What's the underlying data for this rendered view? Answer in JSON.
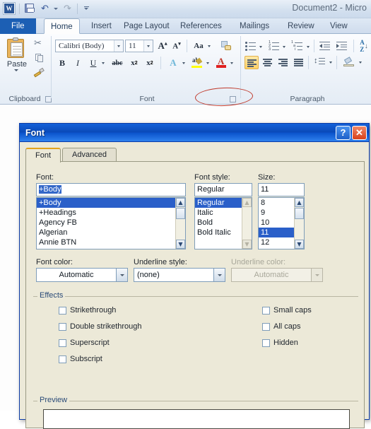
{
  "window": {
    "document_title": "Document2 - Micro",
    "app_logo": "word-logo",
    "quick_access": [
      {
        "name": "save",
        "icon": "floppy-disk-icon"
      },
      {
        "name": "undo",
        "icon": "undo-arrow-icon"
      },
      {
        "name": "redo",
        "icon": "redo-arrow-icon"
      },
      {
        "name": "customize",
        "icon": "customize-qat-icon"
      }
    ]
  },
  "ribbon": {
    "tabs": [
      {
        "label": "File",
        "active": false,
        "style": "file"
      },
      {
        "label": "Home",
        "active": true
      },
      {
        "label": "Insert",
        "active": false
      },
      {
        "label": "Page Layout",
        "active": false
      },
      {
        "label": "References",
        "active": false
      },
      {
        "label": "Mailings",
        "active": false
      },
      {
        "label": "Review",
        "active": false
      },
      {
        "label": "View",
        "active": false
      }
    ],
    "groups": [
      {
        "label": "Clipboard"
      },
      {
        "label": "Font"
      },
      {
        "label": "Paragraph"
      }
    ],
    "clipboard": {
      "paste_label": "Paste",
      "cut_icon": "scissors-icon",
      "copy_icon": "copy-icon",
      "format_painter_icon": "format-painter-icon"
    },
    "font_group": {
      "font_name": "Calibri (Body)",
      "font_size": "11",
      "grow_font": "A",
      "shrink_font": "A",
      "change_case": "Aa",
      "clear_formatting_icon": "clear-formatting-icon",
      "bold": "B",
      "italic": "I",
      "underline": "U",
      "strikethrough": "abc",
      "subscript": "x",
      "superscript": "x",
      "text_effects": "A",
      "highlight": "ab",
      "font_color": "A",
      "font_color_swatch": "#e02020",
      "highlight_swatch": "#ffff00"
    },
    "paragraph_group": {
      "bullets_icon": "bullet-list-icon",
      "numbering_icon": "numbered-list-icon",
      "multilevel_icon": "multilevel-list-icon",
      "decrease_indent_icon": "decrease-indent-icon",
      "increase_indent_icon": "increase-indent-icon",
      "sort_icon": "sort-icon",
      "align_left_icon": "align-left-icon",
      "align_center_icon": "align-center-icon",
      "align_right_icon": "align-right-icon",
      "justify_icon": "justify-icon",
      "line_spacing_icon": "line-spacing-icon",
      "shading_icon": "shading-icon"
    },
    "annotation": {
      "shape": "red-ellipse",
      "color": "#c0392b",
      "target": "font-dialog-launcher"
    }
  },
  "dialog": {
    "title": "Font",
    "help_button": "?",
    "close_button": "✕",
    "tabs": [
      {
        "label": "Font",
        "active": true
      },
      {
        "label": "Advanced",
        "active": false
      }
    ],
    "font": {
      "label": "Font:",
      "value": "+Body",
      "options": [
        "+Body",
        "+Headings",
        "Agency FB",
        "Algerian",
        "Annie BTN"
      ],
      "selected": "+Body"
    },
    "font_style": {
      "label": "Font style:",
      "value": "Regular",
      "options": [
        "Regular",
        "Italic",
        "Bold",
        "Bold Italic"
      ],
      "selected": "Regular"
    },
    "size": {
      "label": "Size:",
      "value": "11",
      "options": [
        "8",
        "9",
        "10",
        "11",
        "12"
      ],
      "selected": "11"
    },
    "font_color": {
      "label": "Font color:",
      "value": "Automatic",
      "disabled": false
    },
    "underline_style": {
      "label": "Underline style:",
      "value": "(none)",
      "disabled": false
    },
    "underline_color": {
      "label": "Underline color:",
      "value": "Automatic",
      "disabled": true
    },
    "effects": {
      "label": "Effects",
      "left": [
        {
          "label": "Strikethrough",
          "checked": false
        },
        {
          "label": "Double strikethrough",
          "checked": false
        },
        {
          "label": "Superscript",
          "checked": false
        },
        {
          "label": "Subscript",
          "checked": false
        }
      ],
      "right": [
        {
          "label": "Small caps",
          "checked": false
        },
        {
          "label": "All caps",
          "checked": false
        },
        {
          "label": "Hidden",
          "checked": false
        }
      ]
    },
    "preview": {
      "label": "Preview",
      "text": ""
    }
  },
  "colors": {
    "dialog_bg": "#ece9d8",
    "titlebar_blue": "#0a49b8",
    "selection_blue": "#2a5fc9",
    "ribbon_file_tab": "#1c5fb4",
    "annotation_red": "#c0392b",
    "tab_accent_orange": "#e3a21a"
  }
}
